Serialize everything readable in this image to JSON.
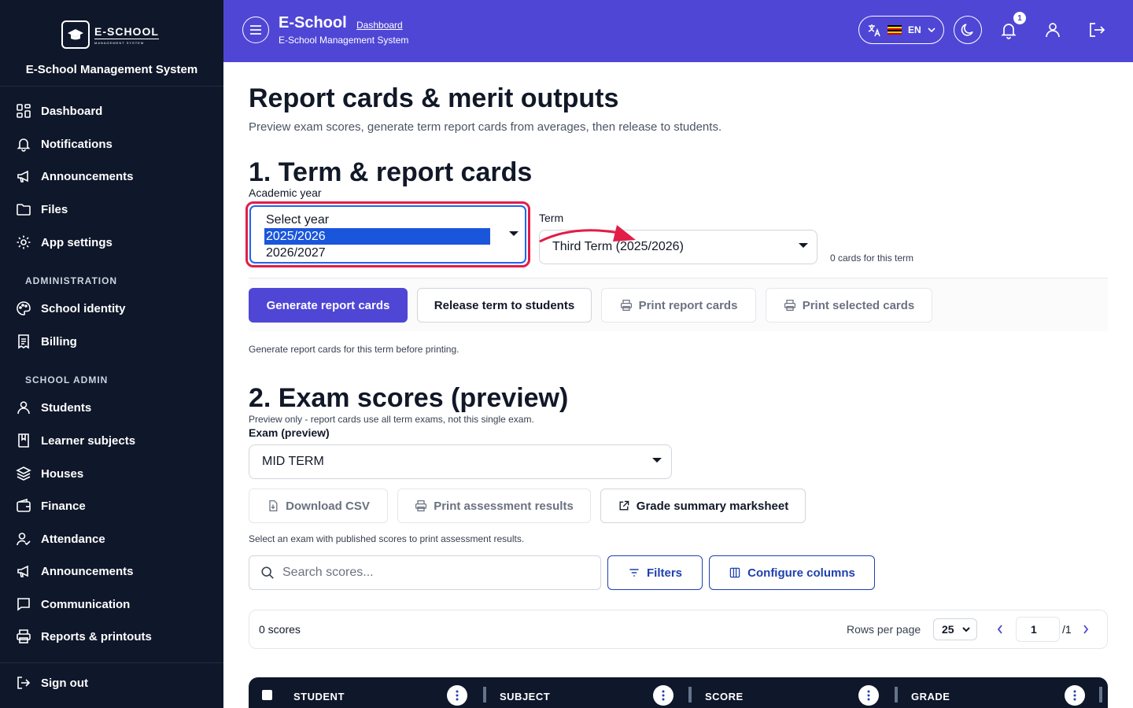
{
  "sidebar": {
    "logo_title": "E-SCHOOL",
    "logo_sub": "MANAGEMENT SYSTEM",
    "brand_name": "E-School Management System",
    "items": [
      {
        "label": "Dashboard",
        "icon": "grid-icon"
      },
      {
        "label": "Notifications",
        "icon": "bell-icon"
      },
      {
        "label": "Announcements",
        "icon": "megaphone-icon"
      },
      {
        "label": "Files",
        "icon": "folder-icon"
      },
      {
        "label": "App settings",
        "icon": "gear-icon"
      }
    ],
    "section_admin": "ADMINISTRATION",
    "admin_items": [
      {
        "label": "School identity",
        "icon": "palette-icon"
      },
      {
        "label": "Billing",
        "icon": "receipt-icon"
      }
    ],
    "section_school": "SCHOOL ADMIN",
    "school_items": [
      {
        "label": "Students",
        "icon": "user-icon"
      },
      {
        "label": "Learner subjects",
        "icon": "book-icon"
      },
      {
        "label": "Houses",
        "icon": "layers-icon"
      },
      {
        "label": "Finance",
        "icon": "wallet-icon"
      },
      {
        "label": "Attendance",
        "icon": "user-check-icon"
      },
      {
        "label": "Announcements",
        "icon": "megaphone-icon"
      },
      {
        "label": "Communication",
        "icon": "chat-icon"
      },
      {
        "label": "Reports & printouts",
        "icon": "printer-icon"
      }
    ],
    "sign_out": "Sign out"
  },
  "header": {
    "title": "E-School",
    "breadcrumb": "Dashboard",
    "subtitle": "E-School Management System",
    "lang": "EN",
    "notif_count": "1"
  },
  "page": {
    "title": "Report cards & merit outputs",
    "description": "Preview exam scores, generate term report cards from averages, then release to students."
  },
  "section1": {
    "title": "1. Term & report cards",
    "year_label": "Academic year",
    "year_options": [
      "Select year",
      "2025/2026",
      "2026/2027"
    ],
    "year_selected": "2025/2026",
    "term_label": "Term",
    "term_value": "Third Term (2025/2026)",
    "cards_count": "0 cards for this term",
    "buttons": {
      "generate": "Generate report cards",
      "release": "Release term to students",
      "print": "Print report cards",
      "print_selected": "Print selected cards"
    },
    "hint": "Generate report cards for this term before printing."
  },
  "section2": {
    "title": "2. Exam scores (preview)",
    "note": "Preview only - report cards use all term exams, not this single exam.",
    "exam_label": "Exam (preview)",
    "exam_value": "MID TERM",
    "buttons": {
      "download": "Download CSV",
      "print_assessment": "Print assessment results",
      "grade_summary": "Grade summary marksheet"
    },
    "hint": "Select an exam with published scores to print assessment results.",
    "search_placeholder": "Search scores...",
    "filters": "Filters",
    "configure": "Configure columns",
    "score_count": "0 scores",
    "rows_label": "Rows per page",
    "rows_value": "25",
    "page_value": "1",
    "page_total": "/1",
    "columns": [
      "STUDENT",
      "SUBJECT",
      "SCORE",
      "GRADE"
    ]
  },
  "colors": {
    "sidebar_bg": "#0f172a",
    "header_bg": "#4f46d6",
    "primary": "#4f46d6",
    "focus_ring": "#e11d48"
  }
}
